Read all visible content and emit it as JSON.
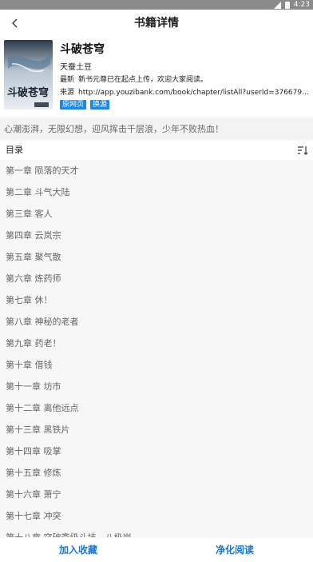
{
  "status_bar": {
    "time": "4:23"
  },
  "header": {
    "title": "书籍详情"
  },
  "book": {
    "title": "斗破苍穹",
    "author": "天蚕土豆",
    "latest_label": "最新",
    "latest_value": "新书元尊已在起点上传，欢迎大家阅读。",
    "source_label": "来源",
    "source_value": "http://app.youzibank.com/book/chapter/listAll?userId=376679...",
    "tag_original": "原网页",
    "tag_change": "换源",
    "cover_calligraphy": "斗破苍穹"
  },
  "intro": "心潮澎湃，无限幻想，迎风挥击千层浪，少年不败热血！",
  "toc": {
    "label": "目录",
    "sort_icon": "sort-icon",
    "chapters": [
      "第一章 陨落的天才",
      "第二章 斗气大陆",
      "第三章 客人",
      "第四章 云岚宗",
      "第五章 聚气散",
      "第六章 炼药师",
      "第七章 休！",
      "第八章 神秘的老者",
      "第九章 药老！",
      "第十章 借钱",
      "第十一章 坊市",
      "第十二章 离他远点",
      "第十三章 黑铁片",
      "第十四章 吸掌",
      "第十五章 修炼",
      "第十六章 萧宁",
      "第十七章 冲突",
      "第十八章 突破斋级斗技，八极崩"
    ]
  },
  "bottom": {
    "add_shelf": "加入收藏",
    "read": "净化阅读"
  },
  "colors": {
    "accent": "#1976d2",
    "tag_bg": "#1e88e5",
    "status_bar": "#8a8a8a"
  }
}
